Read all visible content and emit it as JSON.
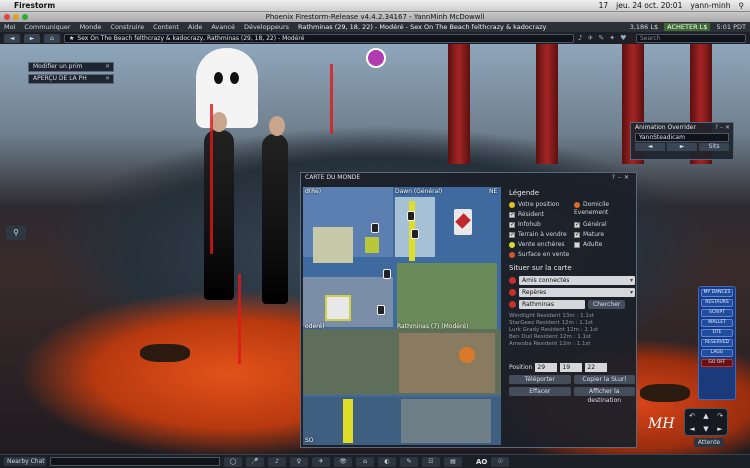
{
  "mac": {
    "app_name": "Firestorm",
    "datetime": "jeu. 24 oct.  20:01",
    "user": "yann-minh",
    "clock_badge": "17"
  },
  "window": {
    "title": "Phoenix Firestorm-Release v4.4.2.34167 - YannMinh McDowwll"
  },
  "viewer_menu": {
    "items": [
      "Moi",
      "Communiquer",
      "Monde",
      "Construire",
      "Content",
      "Aide",
      "Avancé",
      "Développeurs"
    ],
    "location": "Rathminas (29, 18, 22) - Modéré - Sex On The Beach felthcrazy & kadocrazy",
    "balance": "3,186 L$",
    "buy_label": "ACHETER L$",
    "time": "5:01 PDT"
  },
  "navbar": {
    "location": "Sex On The Beach felthcrazy & kadocrazy, Rathminas (29, 18, 22) - Modéré",
    "search_placeholder": "Search"
  },
  "mini_panels": {
    "panel1": "Modifier un prim",
    "panel2": "APERÇU DE LA PH"
  },
  "ao": {
    "title": "Animation Overrider",
    "selected": "YannSteadicam",
    "prev": "◄",
    "next": "►",
    "sit": "Sits"
  },
  "map": {
    "title": "CARTE DU MONDE",
    "legend_title": "Légende",
    "legend": {
      "your_position": "Votre position",
      "home": "Domicile",
      "residents": "Résident",
      "events": "Evenement",
      "infohub": "Infohub",
      "general": "Général",
      "land_sale": "Terrain à vendre",
      "mature": "Mature",
      "adult": "Adulte",
      "auction": "Vente enchères",
      "surface_sale": "Surface en vente"
    },
    "search_title": "Situer sur la carte",
    "friends_online": "Amis connectés",
    "landmarks": "Repères",
    "search_value": "Rathminas",
    "search_button": "Chercher",
    "results": [
      "Windlight Resident 13m : 1.1st",
      "StarGeez Resident 12m : 1.1st",
      "Lurk Grady Resident 12m : 1.1st",
      "Ben Duil Resident 12m : 1.1st",
      "Ameoba Resident 12m : 1.1st"
    ],
    "position_label": "Position",
    "pos_x": "29",
    "pos_y": "19",
    "pos_z": "22",
    "teleport": "Téléporter",
    "copy_slurl": "Copier la SLurl",
    "clear": "Effacer",
    "show_destination": "Afficher la destination",
    "region_labels": {
      "top_left": "d(Ré)",
      "top_center": "Dawn (Général)",
      "center": "Rathminas (7) (Modéré)",
      "left": "odéré)",
      "bottom_left": "SO",
      "top_right": "NE"
    }
  },
  "right_toolbar": {
    "buttons": [
      "MY DANCES",
      "RESTAURS",
      "SCRIPT",
      "WALLET",
      "DTE",
      "RESERVED",
      "LAGG",
      "GO OFF"
    ]
  },
  "controls": {
    "away": "Attente",
    "logo": "MH"
  },
  "bottom": {
    "nearby_chat": "Nearby Chat",
    "buttons": [
      "◯",
      "🎤",
      "♪",
      "♀",
      "✈",
      "👁",
      "⌂",
      "◐",
      "✎",
      "☷",
      "▤",
      "AO",
      "☉"
    ],
    "ao_label": "AO"
  }
}
